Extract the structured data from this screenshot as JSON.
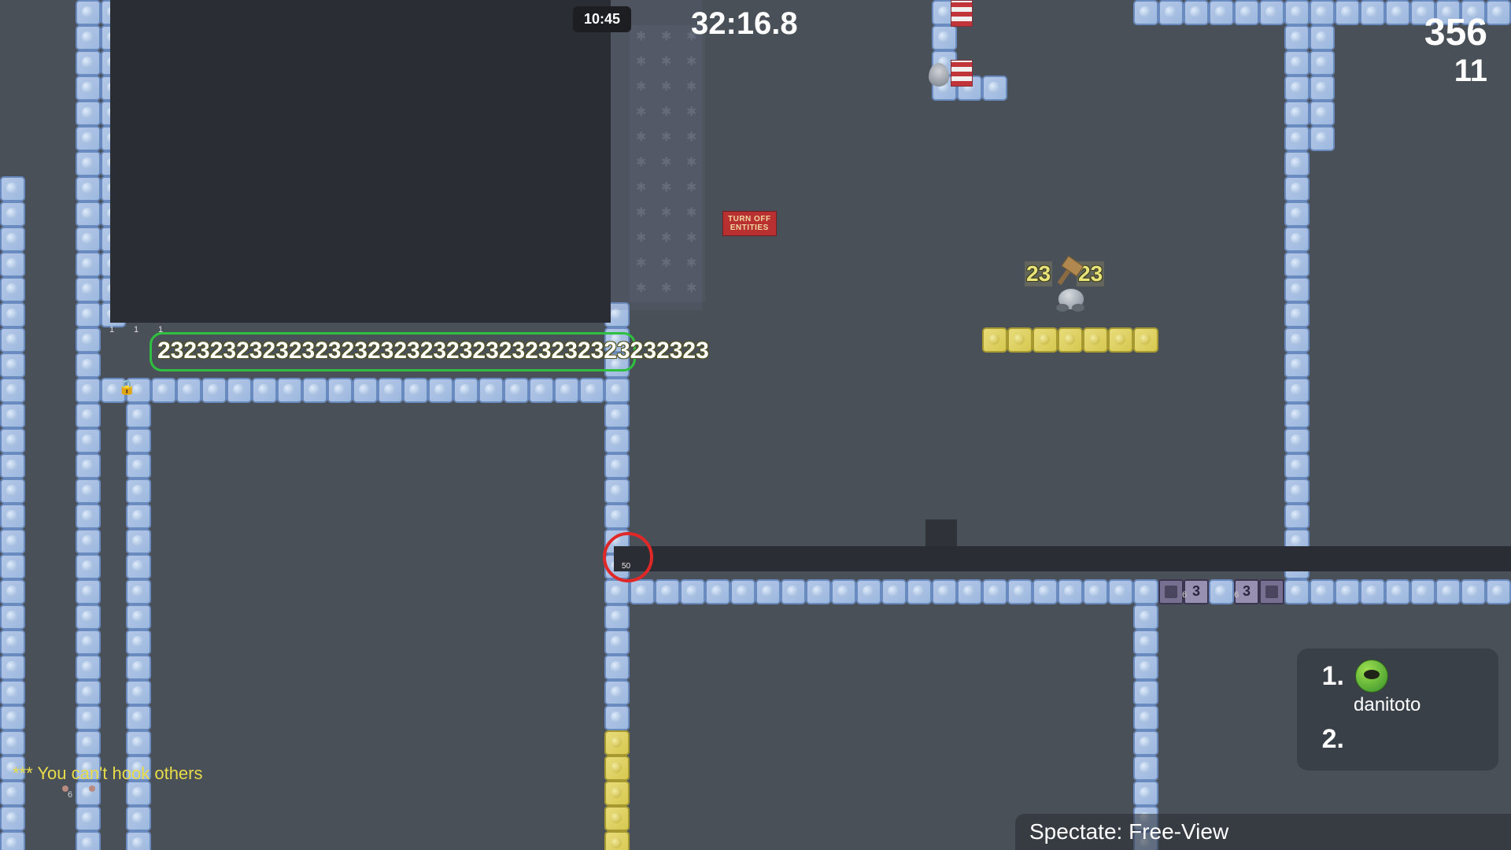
{
  "hud": {
    "clock": "10:45",
    "timer": "32:16.8",
    "score_top": "356",
    "score_bottom": "11"
  },
  "chat": {
    "message": "*** You can't hook others"
  },
  "spectate": {
    "label": "Spectate: Free-View"
  },
  "scoreboard": {
    "rank1": "1.",
    "player1": "danitoto",
    "rank2": "2."
  },
  "entity_sign": {
    "line1": "TURN OFF",
    "line2": "ENTITIES"
  },
  "numbers": {
    "n23a": "23",
    "n23b": "23",
    "row23": "232323232323232323232323232323232323232323",
    "tiny1a": "1",
    "tiny1b": "1",
    "tiny1c": "1",
    "fifty": "50",
    "six1": "6",
    "six2": "6",
    "six3": "6",
    "switch3a": "3",
    "switch3b": "3"
  }
}
